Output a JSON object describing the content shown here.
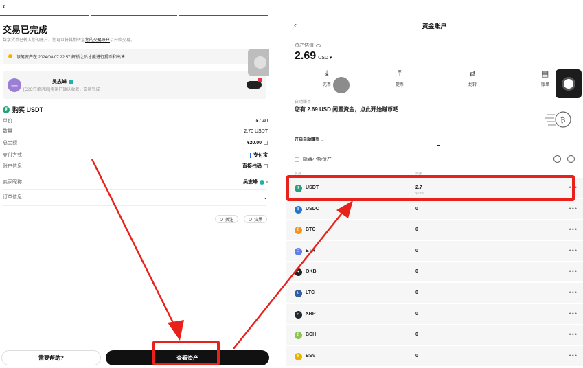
{
  "left": {
    "back_icon": "back-arrow-icon",
    "title": "交易已完成",
    "subtitle_pre": "数字货币已转入您的账户。您可以将其划转至",
    "subtitle_link": "您的交易账户",
    "subtitle_post": "以开始交易。",
    "notice": "该笔资产在 2024/08/07 22:57 解锁之后才能进行提币和出售",
    "merchant": {
      "avatar": "一",
      "name": "吴志峰",
      "desc": "[C2C订单消息]卖家已确认收款，交易完成"
    },
    "buy_title": "购买 USDT",
    "usdt_glyph": "₮",
    "rows": [
      {
        "label": "单价",
        "value": "¥7.40"
      },
      {
        "label": "数量",
        "value": "2.70 USDT"
      },
      {
        "label": "总金额",
        "value": "¥20.00"
      },
      {
        "label": "支付方式",
        "value": "支付宝"
      },
      {
        "label": "账户信息",
        "value": "直接扫码"
      }
    ],
    "seller_label": "卖家昵称",
    "seller_value": "吴志峰",
    "order_info_label": "订单信息",
    "follow_label": "关注",
    "block_label": "拉黑",
    "help_button": "需要帮助?",
    "view_assets_button": "查看资产"
  },
  "right": {
    "back_icon": "back-arrow-icon",
    "title": "资金账户",
    "est_label": "资产估值",
    "balance": "2.69",
    "balance_unit": "USD ▾",
    "actions": [
      {
        "label": "充币",
        "icon": "⤓"
      },
      {
        "label": "提币",
        "icon": "⤒"
      },
      {
        "label": "划转",
        "icon": "⇄"
      },
      {
        "label": "账单",
        "icon": "▤"
      }
    ],
    "auto_label": "自动赚币",
    "auto_text": "您有 2.69 USD 闲置资金，点此开始赚币吧",
    "auto_link": "开启自动赚币 →",
    "hide_small": "隐藏小额资产",
    "col_name": "名称",
    "col_amount": "可用",
    "coins": [
      {
        "name": "USDT",
        "amount": "2.7",
        "sub": "$2.69",
        "color": "#26a17b",
        "glyph": "₮"
      },
      {
        "name": "USDC",
        "amount": "0",
        "sub": "",
        "color": "#2775ca",
        "glyph": "$"
      },
      {
        "name": "BTC",
        "amount": "0",
        "sub": "",
        "color": "#f7931a",
        "glyph": "₿"
      },
      {
        "name": "ETH",
        "amount": "0",
        "sub": "",
        "color": "#627eea",
        "glyph": "Ξ"
      },
      {
        "name": "OKB",
        "amount": "0",
        "sub": "",
        "color": "#222222",
        "glyph": "✦"
      },
      {
        "name": "LTC",
        "amount": "0",
        "sub": "",
        "color": "#345d9d",
        "glyph": "Ł"
      },
      {
        "name": "XRP",
        "amount": "0",
        "sub": "",
        "color": "#23292f",
        "glyph": "✕"
      },
      {
        "name": "BCH",
        "amount": "0",
        "sub": "",
        "color": "#8dc351",
        "glyph": "₿"
      },
      {
        "name": "BSV",
        "amount": "0",
        "sub": "",
        "color": "#eab300",
        "glyph": "B"
      }
    ],
    "more_glyph": "•••"
  },
  "colors": {
    "highlight_red": "#e8221b",
    "primary_dark": "#111111",
    "verify_teal": "#1db3a6"
  }
}
